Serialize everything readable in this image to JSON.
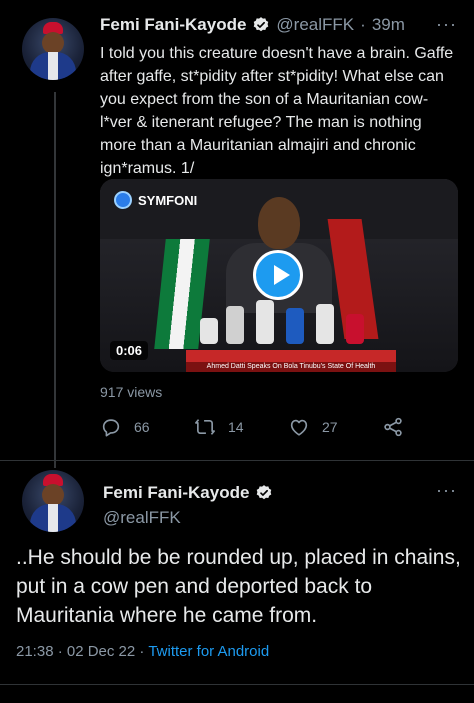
{
  "tweet1": {
    "author_name": "Femi Fani-Kayode",
    "handle": "@realFFK",
    "separator": "·",
    "time": "39m",
    "text": "I told you this creature doesn't have a brain. Gaffe after gaffe, st*pidity after st*pidity! What else can you expect from the son of a Mauritanian cow-l*ver & itenerant refugee? The man is nothing more than a Mauritanian almajiri and chronic ign*ramus. 1/",
    "video": {
      "channel_logo": "SYMFONI",
      "duration": "0:06",
      "caption": "Ahmed Datti Speaks On Bola Tinubu's State Of Health"
    },
    "views": "917 views",
    "actions": {
      "replies": "66",
      "retweets": "14",
      "likes": "27"
    }
  },
  "tweet2": {
    "author_name": "Femi Fani-Kayode",
    "handle": "@realFFK",
    "text": "..He should be be rounded up, placed in chains, put in a cow pen and deported back to Mauritania where he came from.",
    "timestamp": "21:38 · 02 Dec 22 · ",
    "source": "Twitter for Android"
  },
  "icons": {
    "verified": "verified-badge-icon",
    "more": "more-options-icon",
    "reply": "reply-icon",
    "retweet": "retweet-icon",
    "like": "like-icon",
    "share": "share-icon",
    "play": "play-icon"
  },
  "colors": {
    "background": "#000000",
    "text": "#e7e9ea",
    "muted": "#8b98a5",
    "accent": "#1d9bf0"
  }
}
